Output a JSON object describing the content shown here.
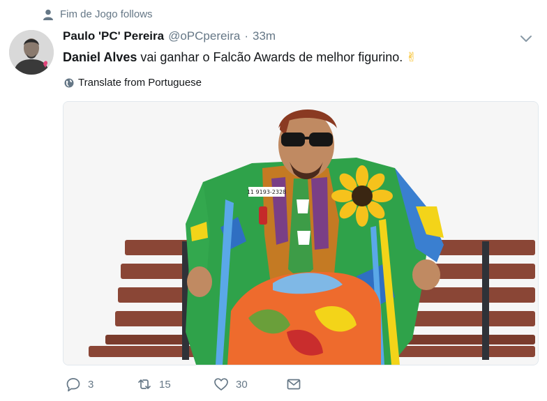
{
  "context": {
    "text": "Fim de Jogo follows"
  },
  "tweet": {
    "author_name": "Paulo 'PC' Pereira",
    "handle": "@oPCpereira",
    "separator": "·",
    "time": "33m",
    "mention": "Daniel Alves",
    "text": " vai ganhar o Falcão Awards de melhor figurino. ",
    "emoji": "✌",
    "translate_label": "Translate from Portuguese"
  },
  "actions": {
    "replies": "3",
    "retweets": "15",
    "likes": "30"
  },
  "media": {
    "badge_text": "11 9193-2328"
  },
  "colors": {
    "text": "#14171a",
    "secondary": "#657786",
    "border": "#e1e8ed",
    "emoji": "#f5c518"
  }
}
